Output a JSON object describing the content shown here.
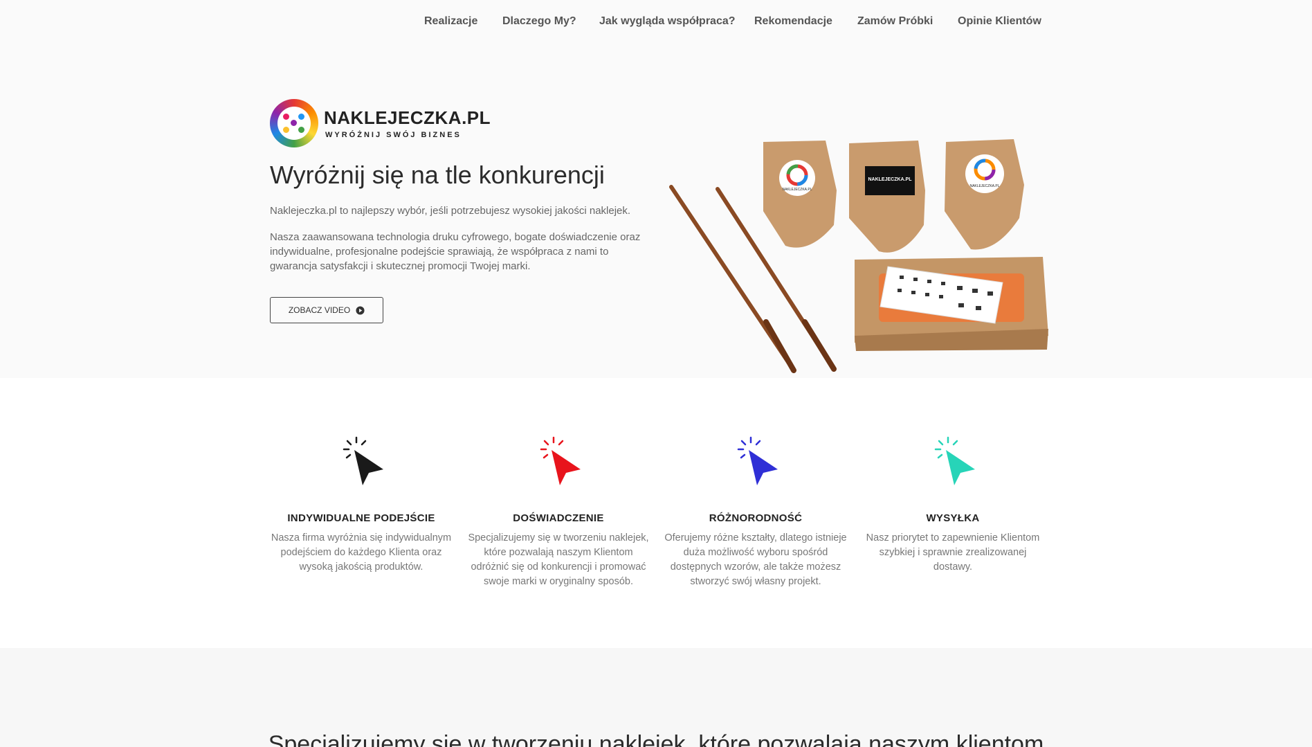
{
  "nav": {
    "items": [
      "Realizacje",
      "Dlaczego My?",
      "Jak wygląda współpraca?",
      "Rekomendacje",
      "Zamów Próbki",
      "Opinie Klientów"
    ]
  },
  "hero": {
    "logo_name": "NAKLEJECZKA.PL",
    "logo_tagline": "WYRÓŻNIJ SWÓJ BIZNES",
    "title": "Wyróżnij się na tle konkurencji",
    "intro": "Naklejeczka.pl to najlepszy wybór, jeśli potrzebujesz wysokiej jakości naklejek.",
    "body": "Nasza zaawansowana technologia druku cyfrowego, bogate doświadczenie oraz indywidualne, profesjonalne podejście sprawiają, że współpraca z nami to gwarancja satysfakcji i skutecznej promocji Twojej marki.",
    "video_button": "ZOBACZ VIDEO",
    "box_label": "NAKLEJECZKA.PL",
    "box_sub": "WYRÓŻNIJ SWÓJ BIZNES"
  },
  "features": [
    {
      "title": "INDYWIDUALNE PODEJŚCIE",
      "desc": "Nasza firma wyróżnia się indywidualnym podejściem do każdego Klienta oraz wysoką jakością produktów.",
      "color": "#1a1a1a",
      "icon": "cursor-click-icon"
    },
    {
      "title": "DOŚWIADCZENIE",
      "desc": "Specjalizujemy się w tworzeniu naklejek, które pozwalają naszym Klientom odróżnić się od konkurencji i promować swoje marki w oryginalny sposób.",
      "color": "#e8141c",
      "icon": "cursor-click-icon"
    },
    {
      "title": "RÓŻNORODNOŚĆ",
      "desc": "Oferujemy różne kształty, dlatego istnieje duża możliwość wyboru spośród dostępnych wzorów, ale także możesz stworzyć swój własny projekt.",
      "color": "#2f2fd6",
      "icon": "cursor-click-icon"
    },
    {
      "title": "WYSYŁKA",
      "desc": "Nasz priorytet to zapewnienie Klientom szybkiej i sprawnie zrealizowanej dostawy.",
      "color": "#27d4b8",
      "icon": "cursor-click-icon"
    }
  ],
  "bottom": {
    "title": "Specjalizujemy się w tworzeniu naklejek, które pozwalają naszym klientom"
  }
}
